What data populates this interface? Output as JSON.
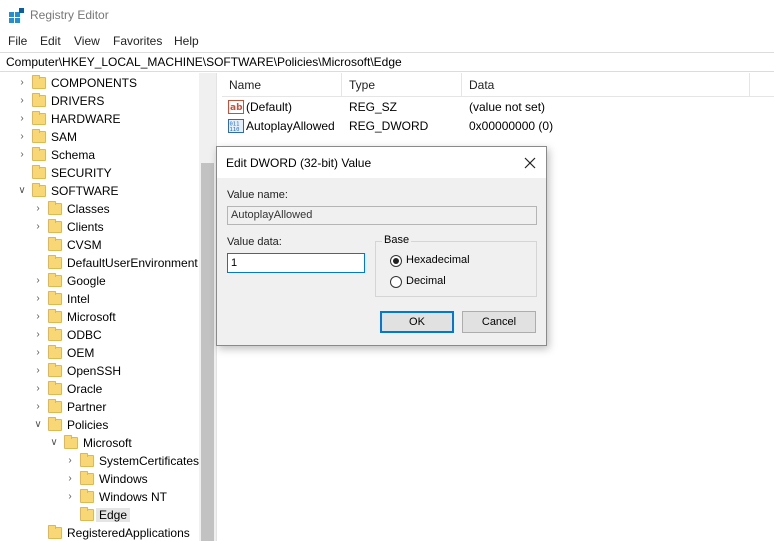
{
  "window": {
    "title": "Registry Editor"
  },
  "menu": [
    "File",
    "Edit",
    "View",
    "Favorites",
    "Help"
  ],
  "address": "Computer\\HKEY_LOCAL_MACHINE\\SOFTWARE\\Policies\\Microsoft\\Edge",
  "tree": [
    {
      "label": "COMPONENTS",
      "level": 1,
      "chevron": "right"
    },
    {
      "label": "DRIVERS",
      "level": 1,
      "chevron": "right"
    },
    {
      "label": "HARDWARE",
      "level": 1,
      "chevron": "right"
    },
    {
      "label": "SAM",
      "level": 1,
      "chevron": "right"
    },
    {
      "label": "Schema",
      "level": 1,
      "chevron": "right"
    },
    {
      "label": "SECURITY",
      "level": 1,
      "chevron": "none"
    },
    {
      "label": "SOFTWARE",
      "level": 1,
      "chevron": "down"
    },
    {
      "label": "Classes",
      "level": 2,
      "chevron": "right"
    },
    {
      "label": "Clients",
      "level": 2,
      "chevron": "right"
    },
    {
      "label": "CVSM",
      "level": 2,
      "chevron": "none"
    },
    {
      "label": "DefaultUserEnvironment",
      "level": 2,
      "chevron": "none"
    },
    {
      "label": "Google",
      "level": 2,
      "chevron": "right"
    },
    {
      "label": "Intel",
      "level": 2,
      "chevron": "right"
    },
    {
      "label": "Microsoft",
      "level": 2,
      "chevron": "right"
    },
    {
      "label": "ODBC",
      "level": 2,
      "chevron": "right"
    },
    {
      "label": "OEM",
      "level": 2,
      "chevron": "right"
    },
    {
      "label": "OpenSSH",
      "level": 2,
      "chevron": "right"
    },
    {
      "label": "Oracle",
      "level": 2,
      "chevron": "right"
    },
    {
      "label": "Partner",
      "level": 2,
      "chevron": "right"
    },
    {
      "label": "Policies",
      "level": 2,
      "chevron": "down"
    },
    {
      "label": "Microsoft",
      "level": 3,
      "chevron": "down"
    },
    {
      "label": "SystemCertificates",
      "level": 4,
      "chevron": "right"
    },
    {
      "label": "Windows",
      "level": 4,
      "chevron": "right"
    },
    {
      "label": "Windows NT",
      "level": 4,
      "chevron": "right"
    },
    {
      "label": "Edge",
      "level": 4,
      "chevron": "none",
      "selected": true
    },
    {
      "label": "RegisteredApplications",
      "level": 2,
      "chevron": "none"
    }
  ],
  "list": {
    "columns": [
      "Name",
      "Type",
      "Data"
    ],
    "rows": [
      {
        "icon": "string-value-icon",
        "name": "(Default)",
        "type": "REG_SZ",
        "data": "(value not set)"
      },
      {
        "icon": "binary-value-icon",
        "name": "AutoplayAllowed",
        "type": "REG_DWORD",
        "data": "0x00000000 (0)"
      }
    ]
  },
  "dialog": {
    "title": "Edit DWORD (32-bit) Value",
    "value_name_label": "Value name:",
    "value_name": "AutoplayAllowed",
    "value_data_label": "Value data:",
    "value_data": "1",
    "base_label": "Base",
    "base_options": [
      "Hexadecimal",
      "Decimal"
    ],
    "base_selected": "Hexadecimal",
    "ok_label": "OK",
    "cancel_label": "Cancel"
  },
  "colors": {
    "accent": "#0078d7",
    "folder": "#f8d777",
    "selection": "#e5e5e5"
  }
}
